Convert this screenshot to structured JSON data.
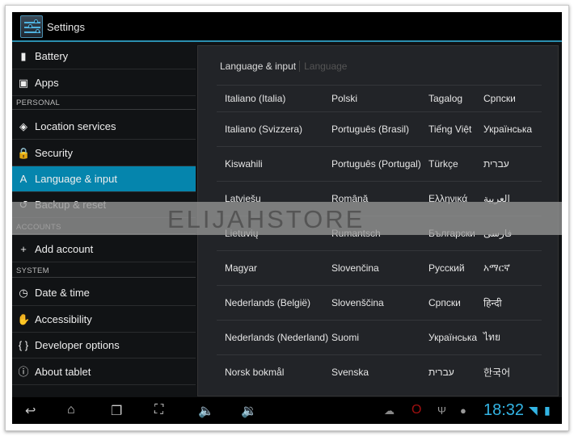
{
  "app": {
    "title": "Settings"
  },
  "sidebar": {
    "items": [
      {
        "label": "Battery",
        "icon": "battery-icon",
        "glyph": "▮"
      },
      {
        "label": "Apps",
        "icon": "apps-icon",
        "glyph": "▣"
      },
      {
        "label": "Location services",
        "icon": "location-icon",
        "glyph": "◈"
      },
      {
        "label": "Security",
        "icon": "lock-icon",
        "glyph": "🔒"
      },
      {
        "label": "Language & input",
        "icon": "language-icon",
        "glyph": "A"
      },
      {
        "label": "Backup & reset",
        "icon": "backup-icon",
        "glyph": "↺"
      },
      {
        "label": "Add account",
        "icon": "plus-icon",
        "glyph": "+"
      },
      {
        "label": "Date & time",
        "icon": "clock-icon",
        "glyph": "◷"
      },
      {
        "label": "Accessibility",
        "icon": "hand-icon",
        "glyph": "✋"
      },
      {
        "label": "Developer options",
        "icon": "braces-icon",
        "glyph": "{ }"
      },
      {
        "label": "About tablet",
        "icon": "info-icon",
        "glyph": "ⓘ"
      }
    ],
    "sections": {
      "personal": "PERSONAL",
      "accounts": "ACCOUNTS",
      "system": "SYSTEM"
    },
    "selected": "Language & input"
  },
  "main": {
    "breadcrumb": {
      "parent": "Language & input",
      "current": "Language"
    },
    "languages": [
      [
        "Italiano (Italia)",
        "Polski",
        "Tagalog",
        "Српски"
      ],
      [
        "Italiano (Svizzera)",
        "Português (Brasil)",
        "Tiếng Việt",
        "Українська"
      ],
      [
        "Kiswahili",
        "Português (Portugal)",
        "Türkçe",
        "עברית"
      ],
      [
        "Latviešu",
        "Română",
        "Ελληνικά",
        "العربية"
      ],
      [
        "Lietuvių",
        "Rumantsch",
        "Български",
        "فارسی"
      ],
      [
        "Magyar",
        "Slovenčina",
        "Русский",
        "አማርኛ"
      ],
      [
        "Nederlands (België)",
        "Slovenščina",
        "Српски",
        "हिन्दी"
      ],
      [
        "Nederlands (Nederland)",
        "Suomi",
        "Українська",
        "ไทย"
      ],
      [
        "Norsk bokmål",
        "Svenska",
        "עברית",
        "한국어"
      ]
    ]
  },
  "statusbar": {
    "time": "18:32"
  },
  "watermark": "ELIJAHSTORE",
  "colors": {
    "accent": "#0585ad",
    "clock": "#33b5e5"
  }
}
